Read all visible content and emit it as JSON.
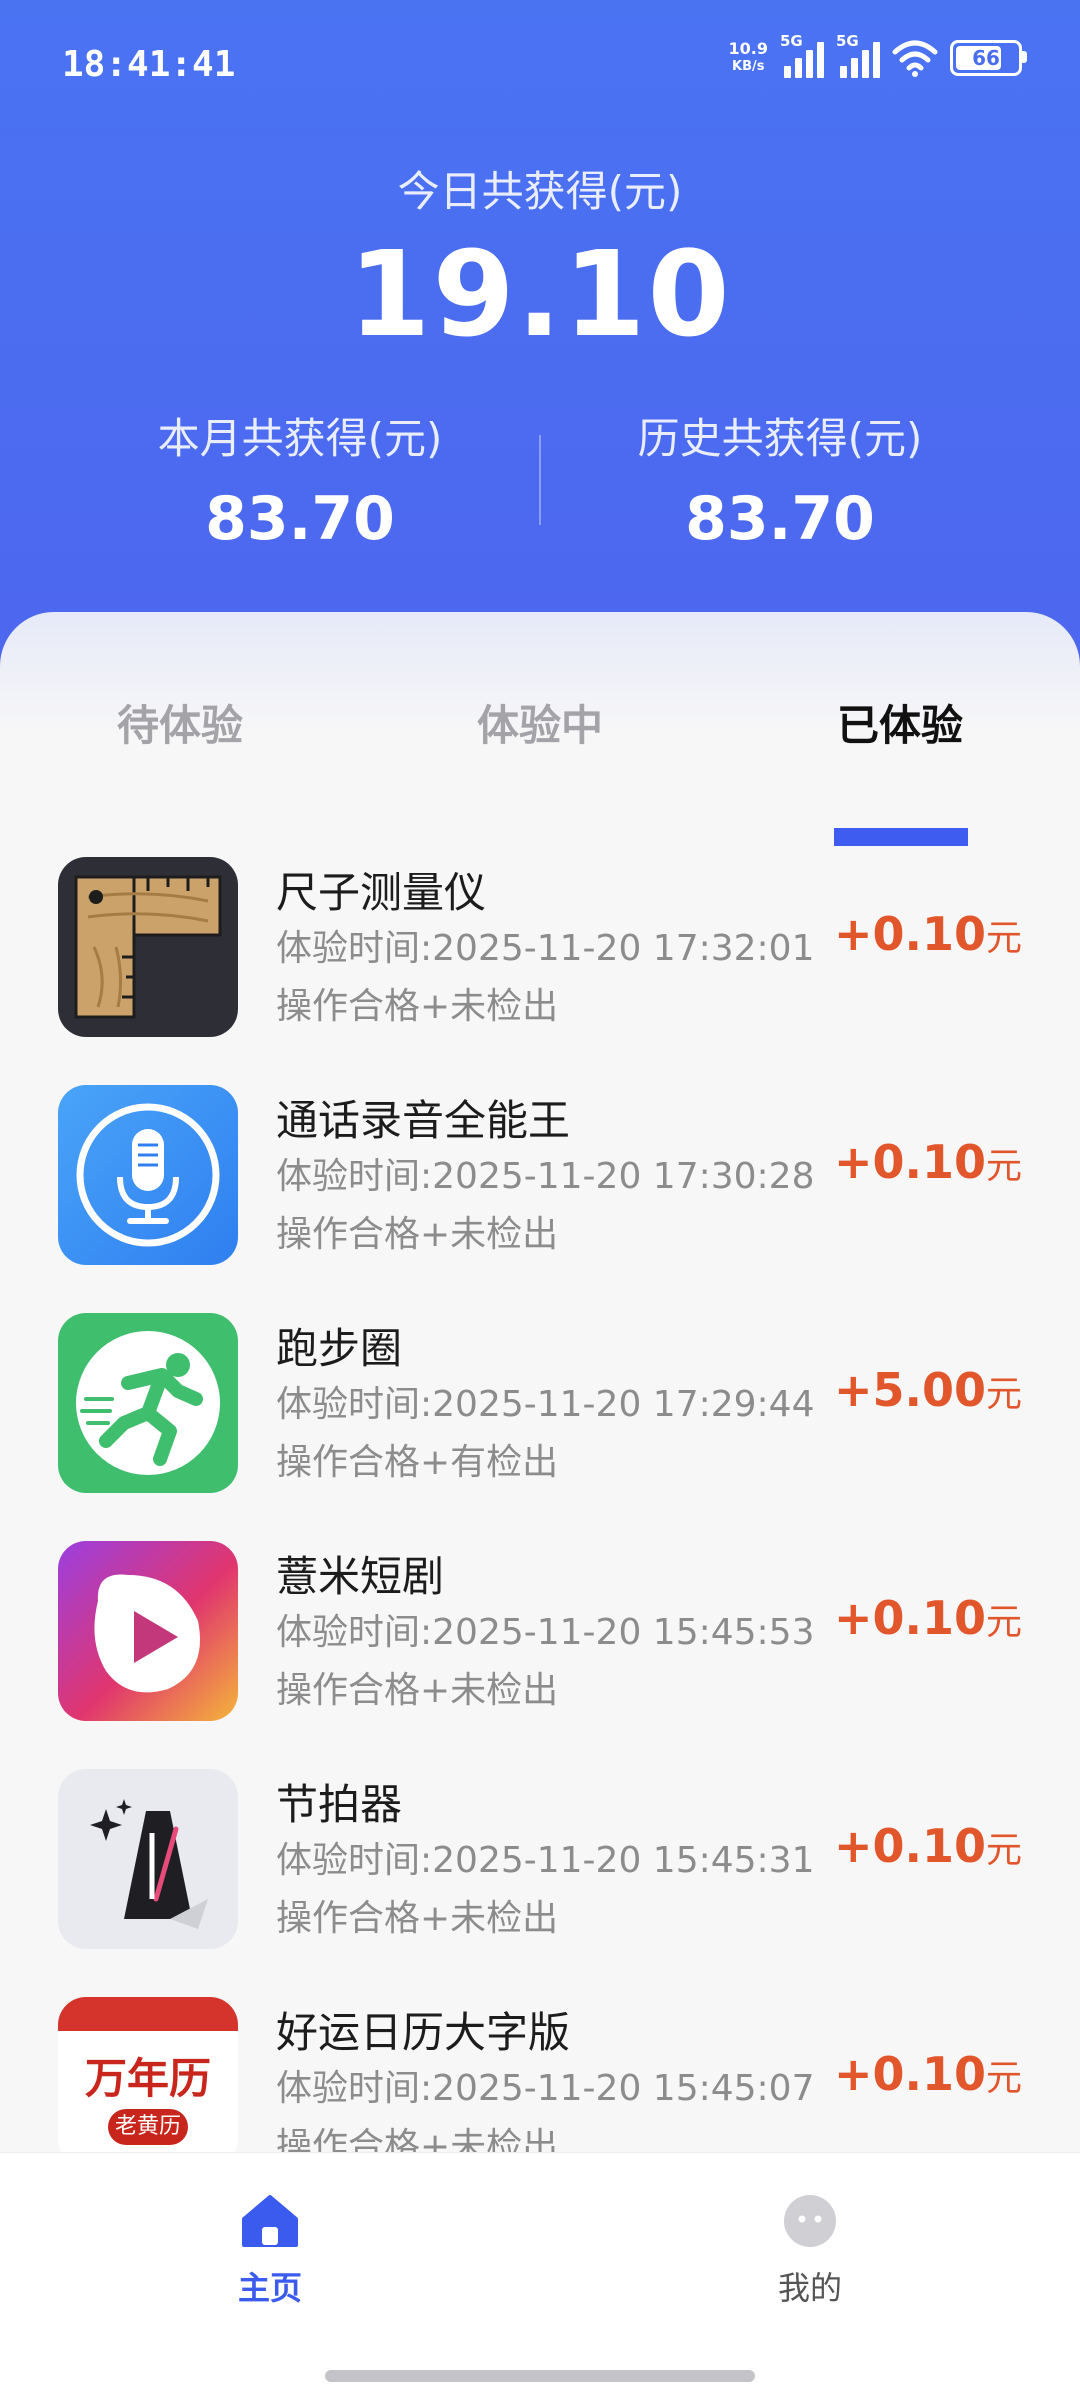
{
  "status_bar": {
    "time": "18:41:41",
    "net_speed_value": "10.9",
    "net_speed_unit": "KB/s",
    "sim1_tag": "5G",
    "sim2_tag": "5G",
    "battery": "66"
  },
  "summary": {
    "today_label": "今日共获得(元)",
    "today_amount": "19.10",
    "month_label": "本月共获得(元)",
    "month_amount": "83.70",
    "history_label": "历史共获得(元)",
    "history_amount": "83.70"
  },
  "tabs": [
    {
      "label": "待体验",
      "active": false
    },
    {
      "label": "体验中",
      "active": false
    },
    {
      "label": "已体验",
      "active": true
    }
  ],
  "items": [
    {
      "name": "尺子测量仪",
      "time": "体验时间:2025-11-20 17:32:01",
      "status": "操作合格+未检出",
      "amount": "+0.10",
      "unit": "元",
      "icon": "ruler-app-icon"
    },
    {
      "name": "通话录音全能王",
      "time": "体验时间:2025-11-20 17:30:28",
      "status": "操作合格+未检出",
      "amount": "+0.10",
      "unit": "元",
      "icon": "microphone-app-icon"
    },
    {
      "name": "跑步圈",
      "time": "体验时间:2025-11-20 17:29:44",
      "status": "操作合格+有检出",
      "amount": "+5.00",
      "unit": "元",
      "icon": "runner-app-icon"
    },
    {
      "name": "薏米短剧",
      "time": "体验时间:2025-11-20 15:45:53",
      "status": "操作合格+未检出",
      "amount": "+0.10",
      "unit": "元",
      "icon": "play-app-icon"
    },
    {
      "name": "节拍器",
      "time": "体验时间:2025-11-20 15:45:31",
      "status": "操作合格+未检出",
      "amount": "+0.10",
      "unit": "元",
      "icon": "metronome-app-icon"
    },
    {
      "name": "好运日历大字版",
      "time": "体验时间:2025-11-20 15:45:07",
      "status": "操作合格+未检出",
      "amount": "+0.10",
      "unit": "元",
      "icon": "calendar-app-icon",
      "icon_text_main": "万年历",
      "icon_text_sub": "老黄历"
    }
  ],
  "bottom_nav": {
    "home_label": "主页",
    "mine_label": "我的"
  },
  "colors": {
    "header_blue": "#4a73f2",
    "accent_blue": "#3b5bef",
    "reward_orange": "#e1572b"
  }
}
